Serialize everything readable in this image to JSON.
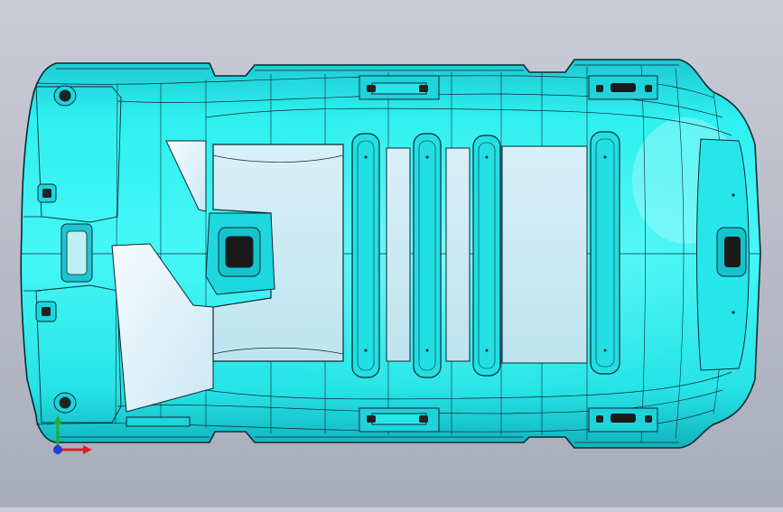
{
  "viewport": {
    "background_top": "#c9ccd6",
    "background_bottom": "#a9adba"
  },
  "model": {
    "name": "",
    "body_color": "#2fe8e8",
    "highlight_color": "#8af5f5",
    "shadow_color": "#12b9c4",
    "edge_color": "#0a2a33",
    "cutout_color": "#e6f4fb",
    "pocket_color": "#1a1a1a"
  },
  "triad": {
    "x_axis_color": "#e02020",
    "y_axis_color": "#21b021",
    "z_axis_color": "#1e3fd8",
    "icon": "coordinate-triad-icon"
  }
}
